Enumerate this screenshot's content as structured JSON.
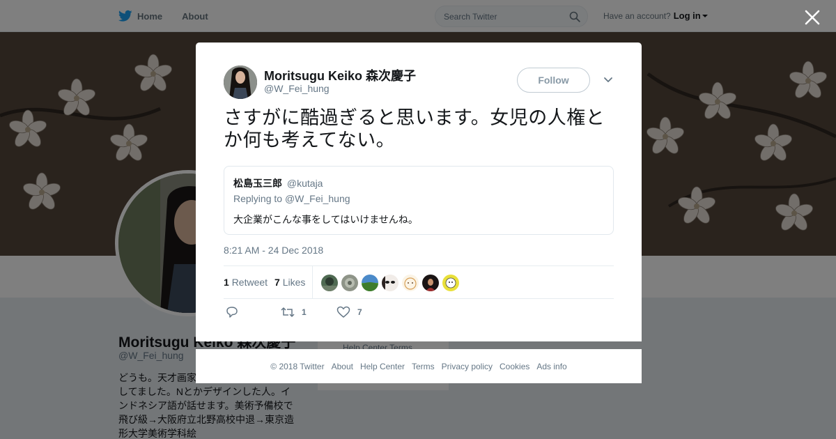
{
  "nav": {
    "home_label": "Home",
    "about_label": "About",
    "search_placeholder": "Search Twitter",
    "account_prompt": "Have an account?",
    "login_label": "Log in",
    "brand_color": "#1da1f2",
    "icons": [
      "twitter-bird-icon",
      "search-icon",
      "caret-down-icon",
      "close-icon"
    ]
  },
  "profile": {
    "name": "Moritsugu Keiko 森次慶子",
    "handle": "@W_Fei_hung",
    "bio": "どうも。天才画家観設計、キャラデザをしてました。Nとかデザインした人。インドネシア語が話せます。美術予備校で飛び級→大阪府立北野高校中退→東京造形大学美術学科絵",
    "side_links": "Help Center   Terms"
  },
  "tweet": {
    "author_name": "Moritsugu Keiko 森次慶子",
    "author_handle": "@W_Fei_hung",
    "follow_label": "Follow",
    "text": "さすがに酷過ぎると思います。女児の人権とか何も考えてない。",
    "quote": {
      "name": "松島玉三郎",
      "handle": "@kutaja",
      "replying_prefix": "Replying to",
      "replying_to": "@W_Fei_hung",
      "text": "大企業がこんな事をしてはいけませんね。"
    },
    "timestamp": "8:21 AM - 24 Dec 2018",
    "retweet_count": "1",
    "retweet_label": "Retweet",
    "like_count": "7",
    "like_label": "Likes",
    "action_retweet_count": "1",
    "action_like_count": "7"
  },
  "footer": {
    "copyright": "© 2018 Twitter",
    "links": [
      "About",
      "Help Center",
      "Terms",
      "Privacy policy",
      "Cookies",
      "Ads info"
    ]
  }
}
